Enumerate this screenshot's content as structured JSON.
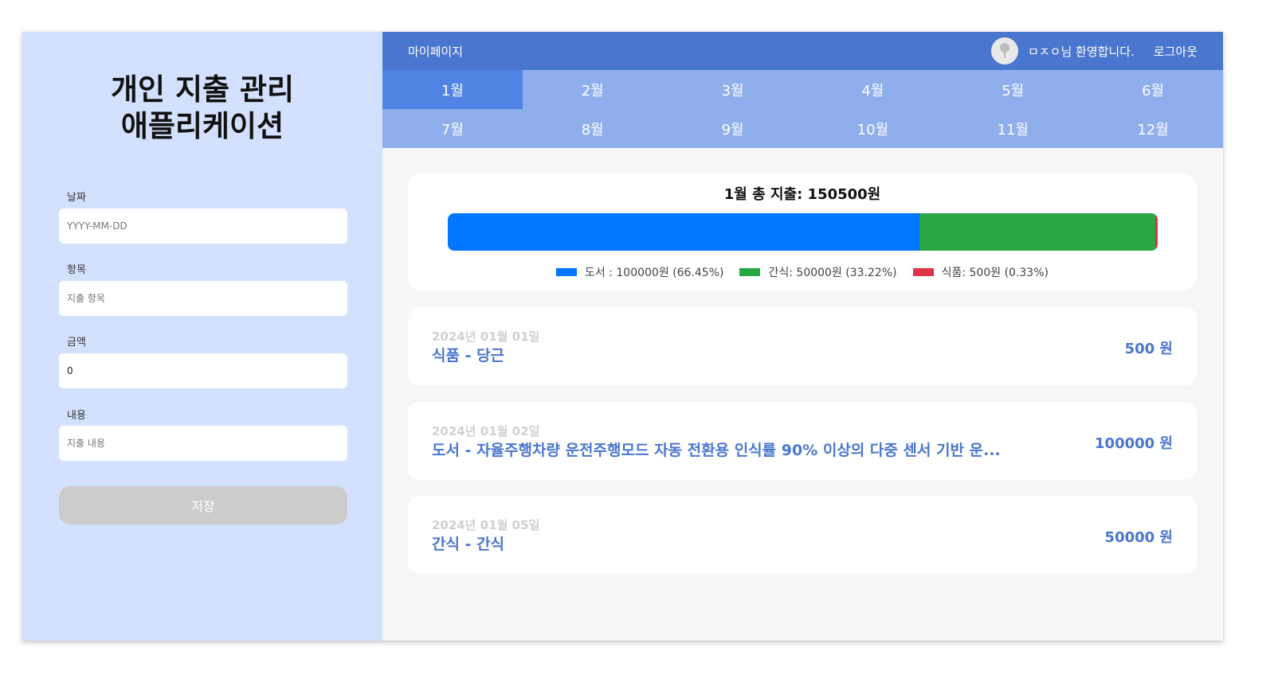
{
  "app_title_line1": "개인 지출 관리",
  "app_title_line2": "애플리케이션",
  "form": {
    "date_label": "날짜",
    "date_placeholder": "YYYY-MM-DD",
    "item_label": "항목",
    "item_placeholder": "지출 항목",
    "amount_label": "금액",
    "amount_value": "0",
    "content_label": "내용",
    "content_placeholder": "지출 내용",
    "save_label": "저장"
  },
  "header": {
    "mypage": "마이페이지",
    "welcome": "ㅁㅈㅇ님 환영합니다.",
    "logout": "로그아웃"
  },
  "months": [
    "1월",
    "2월",
    "3월",
    "4월",
    "5월",
    "6월",
    "7월",
    "8월",
    "9월",
    "10월",
    "11월",
    "12월"
  ],
  "active_month": "1월",
  "summary": {
    "title": "1월 총 지출: 150500원"
  },
  "chart_data": {
    "type": "bar",
    "stacked": true,
    "title": "1월 총 지출: 150500원",
    "total": 150500,
    "series": [
      {
        "name": "도서",
        "value": 100000,
        "percent": 66.45,
        "color": "#0077ff",
        "legend": "도서 : 100000원 (66.45%)"
      },
      {
        "name": "간식",
        "value": 50000,
        "percent": 33.22,
        "color": "#28a745",
        "legend": "간식: 50000원 (33.22%)"
      },
      {
        "name": "식품",
        "value": 500,
        "percent": 0.33,
        "color": "#dc3545",
        "legend": "식품: 500원 (0.33%)"
      }
    ]
  },
  "expenses": [
    {
      "date": "2024년 01월 01일",
      "title": "식품 - 당근",
      "amount": "500 원"
    },
    {
      "date": "2024년 01월 02일",
      "title": "도서 - 자율주행차량 운전주행모드 자동 전환용 인식률 90% 이상의 다중 센서 기반 운...",
      "amount": "100000 원"
    },
    {
      "date": "2024년 01월 05일",
      "title": "간식 - 간식",
      "amount": "50000 원"
    }
  ],
  "colors": {
    "header": "#4a76cf",
    "month_bar": "#8faeec",
    "month_active": "#5083e4",
    "left_panel": "#d4e1fe"
  }
}
